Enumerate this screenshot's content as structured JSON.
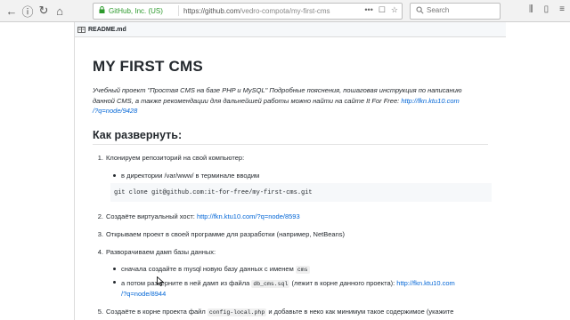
{
  "browser": {
    "company": "GitHub, Inc. (US)",
    "url_base": "https://github.com",
    "url_path": "/vedro-compota/my-first-cms",
    "search_placeholder": "Search"
  },
  "file": {
    "name": "README.md"
  },
  "readme": {
    "title": "MY FIRST CMS",
    "intro_text": "Учебный проект \"Простая CMS на базе PHP и MySQL\" Подробные пояснения, пошаговая инструкция по написанию данной CMS, а также рекомендации для дальнейшей работы можно найти на сайте It For Free:",
    "intro_link_1": "http://fkn.ktu10.com",
    "intro_link_2": "/?q=node/9428",
    "section_title": "Как развернуть:",
    "steps": [
      {
        "num": "1.",
        "text": "Клонируем репозиторий на свой компьютер:"
      },
      {
        "num": "2.",
        "text": "Создаёте виртуальный хост:",
        "link": "http://fkn.ktu10.com/?q=node/8593"
      },
      {
        "num": "3.",
        "text": "Открываем проект в своей программе для разработки (например, NetBeans)"
      },
      {
        "num": "4.",
        "text": "Разворачиваем дамп базы данных:"
      },
      {
        "num": "5.",
        "text_a": "Создаёте в корне проекта файл",
        "code": "config-local.php",
        "text_b": "и добавьте в неко как минимум такое содержимое (укажите"
      }
    ],
    "step1_bullet": "в директории /var/www/ в терминале вводим",
    "step1_code": "git clone git@github.com:it-for-free/my-first-cms.git",
    "step4_bullet1_text": "сначала создайте в mysql новую базу данных с именем",
    "step4_bullet1_code": "cms",
    "step4_bullet2_text_a": "а потом разверните в ней дамп из файла",
    "step4_bullet2_code": "db_cms.sql",
    "step4_bullet2_text_b": "(лежит в корне данного проекта):",
    "step4_bullet2_link_1": "http://fkn.ktu10.com",
    "step4_bullet2_link_2": "/?q=node/8944"
  }
}
